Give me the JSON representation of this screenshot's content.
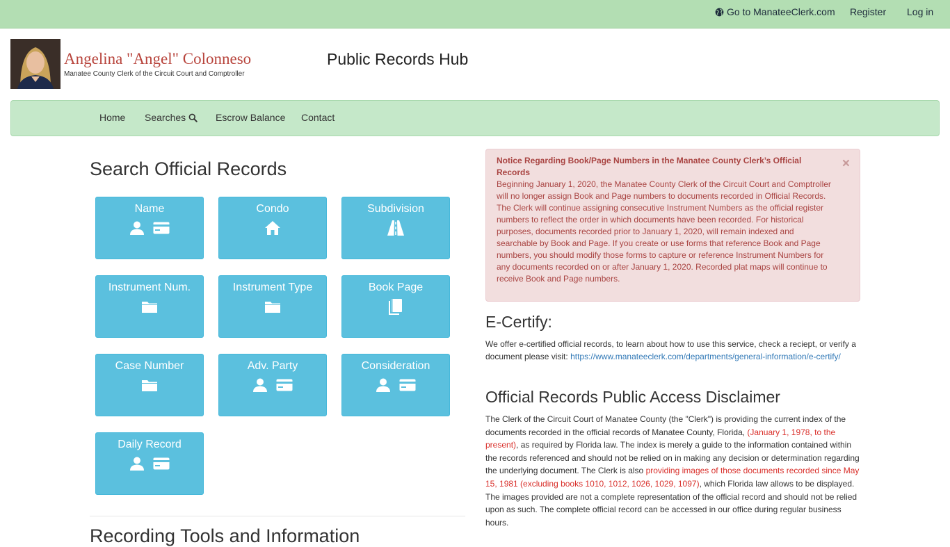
{
  "topbar": {
    "goto_label": "Go to ManateeClerk.com",
    "register_label": "Register",
    "login_label": "Log in"
  },
  "header": {
    "clerk_name": "Angelina \"Angel\" Colonneso",
    "clerk_title": "Manatee County Clerk of the Circuit Court and Comptroller",
    "hub_title": "Public Records Hub"
  },
  "nav": {
    "home": "Home",
    "searches": "Searches",
    "escrow": "Escrow Balance",
    "contact": "Contact"
  },
  "search": {
    "title": "Search Official Records",
    "tiles": [
      {
        "label": "Name",
        "icons": [
          "user-icon",
          "id-card-icon"
        ]
      },
      {
        "label": "Condo",
        "icons": [
          "home-icon"
        ]
      },
      {
        "label": "Subdivision",
        "icons": [
          "road-icon"
        ]
      },
      {
        "label": "Instrument Num.",
        "icons": [
          "folder-icon"
        ]
      },
      {
        "label": "Instrument Type",
        "icons": [
          "folder-icon"
        ]
      },
      {
        "label": "Book Page",
        "icons": [
          "book-icon"
        ]
      },
      {
        "label": "Case Number",
        "icons": [
          "folder-icon"
        ]
      },
      {
        "label": "Adv. Party",
        "icons": [
          "user-icon",
          "id-card-icon"
        ]
      },
      {
        "label": "Consideration",
        "icons": [
          "user-icon",
          "id-card-icon"
        ]
      },
      {
        "label": "Daily Record",
        "icons": [
          "user-icon",
          "id-card-icon"
        ]
      }
    ],
    "bottom_heading": "Recording Tools and Information"
  },
  "notice": {
    "title": "Notice Regarding Book/Page Numbers in the Manatee County Clerk’s Official Records",
    "body": "Beginning January 1, 2020, the Manatee County Clerk of the Circuit Court and Comptroller will no longer assign Book and Page numbers to documents recorded in Official Records. The Clerk will continue assigning consecutive Instrument Numbers as the official register numbers to reflect the order in which documents have been recorded. For historical purposes, documents recorded prior to January 1, 2020, will remain indexed and searchable by Book and Page. If you create or use forms that reference Book and Page numbers, you should modify those forms to capture or reference Instrument Numbers for any documents recorded on or after January 1, 2020. Recorded plat maps will continue to receive Book and Page numbers.",
    "close": "×"
  },
  "ecertify": {
    "title": "E-Certify:",
    "text": "We offer e-certified official records, to learn about how to use this service, check a reciept, or verify a document please visit: ",
    "link": "https://www.manateeclerk.com/departments/general-information/e-certify/"
  },
  "disclaimer": {
    "title": "Official Records Public Access Disclaimer",
    "p1": "The Clerk of the Circuit Court of Manatee County (the \"Clerk\") is providing the current index of the documents recorded in the official records of Manatee County, Florida, ",
    "r1": "(January 1, 1978, to the present)",
    "p2": ", as required by Florida law. The index is merely a guide to the information contained within the records referenced and should not be relied on in making any decision or determination regarding the underlying document. The Clerk is also ",
    "r2": "providing images of those documents recorded since May 15, 1981 (excluding books 1010, 1012, 1026, 1029, 1097)",
    "p3": ", which Florida law allows to be displayed. The images provided are not a complete representation of the official record and should not be relied upon as such. The complete official record can be accessed in our office during regular business hours."
  },
  "colors": {
    "topbar": "#b3deb3",
    "navbar": "#c5e8c9",
    "tile": "#5bc0de",
    "alert_bg": "#f2dede",
    "alert_text": "#a94442",
    "name_red": "#b8453d",
    "link_blue": "#337ab7",
    "emphasis_red": "#d9302b"
  }
}
